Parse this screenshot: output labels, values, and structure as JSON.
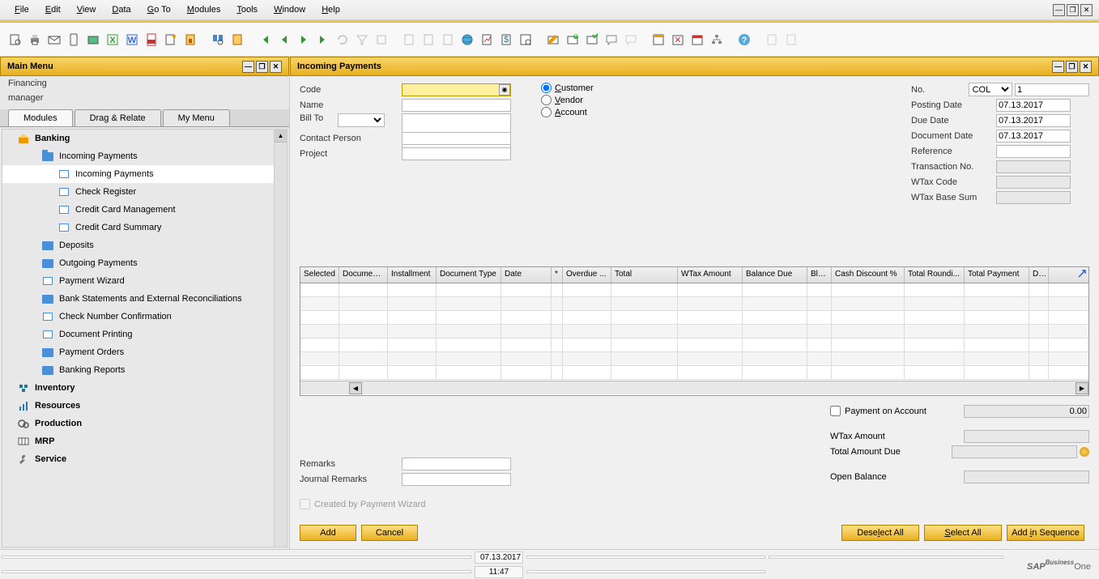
{
  "menubar": {
    "items": [
      "File",
      "Edit",
      "View",
      "Data",
      "Go To",
      "Modules",
      "Tools",
      "Window",
      "Help"
    ]
  },
  "leftPanel": {
    "title": "Main Menu",
    "subtitle1": "Financing",
    "subtitle2": "manager",
    "tabs": [
      "Modules",
      "Drag & Relate",
      "My Menu"
    ],
    "tree": {
      "banking": "Banking",
      "incomingPayments": "Incoming Payments",
      "incomingPaymentsSub": "Incoming Payments",
      "checkRegister": "Check Register",
      "creditCardMgmt": "Credit Card Management",
      "creditCardSummary": "Credit Card Summary",
      "deposits": "Deposits",
      "outgoingPayments": "Outgoing Payments",
      "paymentWizard": "Payment Wizard",
      "bankStatements": "Bank Statements and External Reconciliations",
      "checkNumber": "Check Number Confirmation",
      "documentPrinting": "Document Printing",
      "paymentOrders": "Payment Orders",
      "bankingReports": "Banking Reports",
      "inventory": "Inventory",
      "resources": "Resources",
      "production": "Production",
      "mrp": "MRP",
      "service": "Service"
    }
  },
  "form": {
    "title": "Incoming Payments",
    "labels": {
      "code": "Code",
      "name": "Name",
      "billTo": "Bill To",
      "contactPerson": "Contact Person",
      "project": "Project",
      "no": "No.",
      "postingDate": "Posting Date",
      "dueDate": "Due Date",
      "documentDate": "Document Date",
      "reference": "Reference",
      "transactionNo": "Transaction No.",
      "wtaxCode": "WTax Code",
      "wtaxBaseSum": "WTax Base Sum",
      "paymentOnAccount": "Payment on Account",
      "wtaxAmount": "WTax Amount",
      "totalAmountDue": "Total Amount Due",
      "openBalance": "Open Balance",
      "remarks": "Remarks",
      "journalRemarks": "Journal Remarks",
      "createdByWizard": "Created by Payment Wizard"
    },
    "radios": {
      "customer": "Customer",
      "vendor": "Vendor",
      "account": "Account"
    },
    "values": {
      "noSeries": "COL",
      "noValue": "1",
      "postingDate": "07.13.2017",
      "dueDate": "07.13.2017",
      "documentDate": "07.13.2017",
      "paymentOnAccount": "0.00"
    },
    "gridHeaders": [
      "Selected",
      "Documen...",
      "Installment",
      "Document Type",
      "Date",
      "*",
      "Overdue ...",
      "Total",
      "WTax Amount",
      "Balance Due",
      "Blo...",
      "Cash Discount %",
      "Total Roundi...",
      "Total Payment",
      "D..."
    ],
    "buttons": {
      "add": "Add",
      "cancel": "Cancel",
      "deselectAll": "Deselect All",
      "selectAll": "Select All",
      "addInSequence": "Add in Sequence"
    }
  },
  "statusbar": {
    "date": "07.13.2017",
    "time": "11:47"
  },
  "logo": {
    "brand": "SAP",
    "suffix": "Business",
    "one": "One"
  }
}
